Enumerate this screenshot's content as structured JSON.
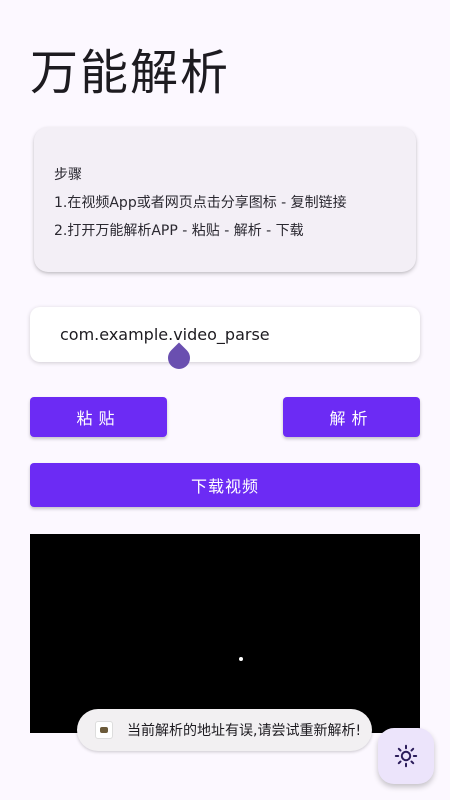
{
  "app": {
    "title": "万能解析"
  },
  "steps": {
    "heading": "步骤",
    "step1": "1.在视频App或者网页点击分享图标 - 复制链接",
    "step2": "2.打开万能解析APP - 粘贴 - 解析 - 下载"
  },
  "url_input": {
    "value": "com.example.video_parse"
  },
  "buttons": {
    "paste_label": "粘贴",
    "parse_label": "解析",
    "download_label": "下载视频"
  },
  "toast": {
    "message": "当前解析的地址有误,请尝试重新解析!"
  },
  "fab": {
    "icon": "sun-icon"
  },
  "colors": {
    "accent": "#6c2bf4",
    "background": "#fcf8ff",
    "card": "#f3eff6"
  }
}
